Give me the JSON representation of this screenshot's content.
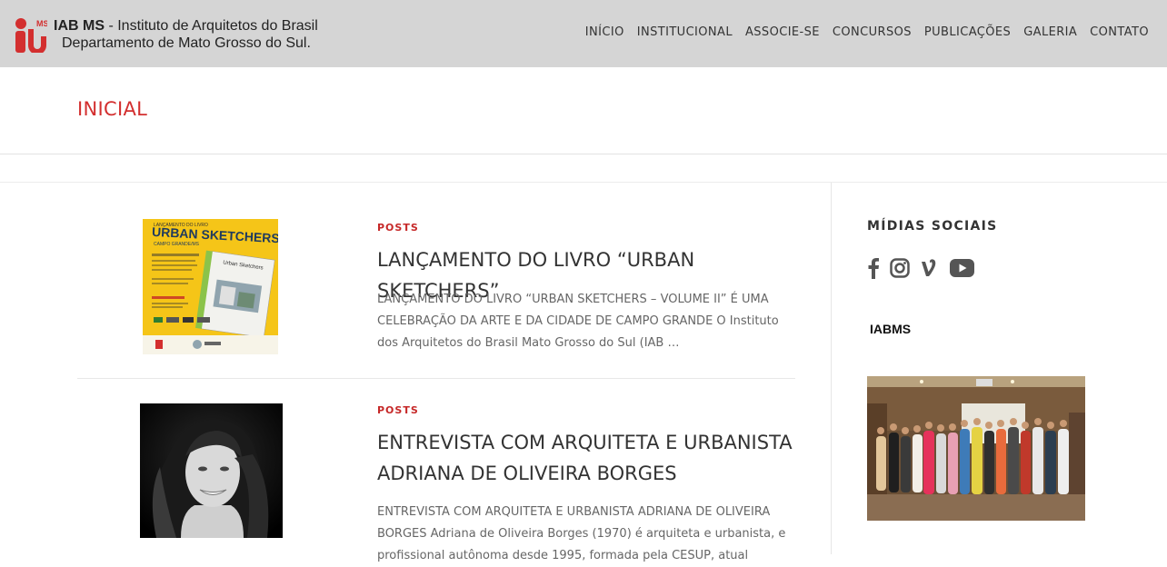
{
  "header": {
    "brand_strong": "IAB MS",
    "brand_line1": " - Instituto de Arquitetos do Brasil",
    "brand_line2": "Departamento de Mato Grosso do Sul.",
    "logo_small": "MS",
    "nav": [
      "INÍCIO",
      "INSTITUCIONAL",
      "ASSOCIE-SE",
      "CONCURSOS",
      "PUBLICAÇÕES",
      "GALERIA",
      "CONTATO"
    ]
  },
  "page_title": "INICIAL",
  "posts": [
    {
      "category": "POSTS",
      "title": "LANÇAMENTO DO LIVRO “URBAN SKETCHERS”",
      "excerpt": "LANÇAMENTO DO LIVRO “URBAN SKETCHERS – VOLUME II” É UMA CELEBRAÇÃO DA ARTE E DA CIDADE DE CAMPO GRANDE O Instituto dos Arquitetos do Brasil Mato Grosso do Sul (IAB …",
      "thumb": {
        "small": "LANÇAMENTO DO LIVRO",
        "big": "URBAN SKETCHERS",
        "sub": "CAMPO GRANDE/MS",
        "book": "Urban Sketchers"
      }
    },
    {
      "category": "POSTS",
      "title": "ENTREVISTA COM ARQUITETA E URBANISTA ADRIANA DE OLIVEIRA BORGES",
      "excerpt": "ENTREVISTA COM ARQUITETA E URBANISTA ADRIANA DE OLIVEIRA BORGES   Adriana de Oliveira Borges (1970) é arquiteta e urbanista, e profissional autônoma desde 1995, formada pela CESUP, atual"
    }
  ],
  "sidebar": {
    "social_title": "MÍDIAS SOCIAIS",
    "social_icons": [
      "facebook-icon",
      "instagram-icon",
      "vine-icon",
      "youtube-icon"
    ],
    "iab_label": "IABMS"
  },
  "colors": {
    "accent": "#d32f2f",
    "header_bg": "#d5d5d5",
    "thumb_yellow": "#f5c518"
  }
}
